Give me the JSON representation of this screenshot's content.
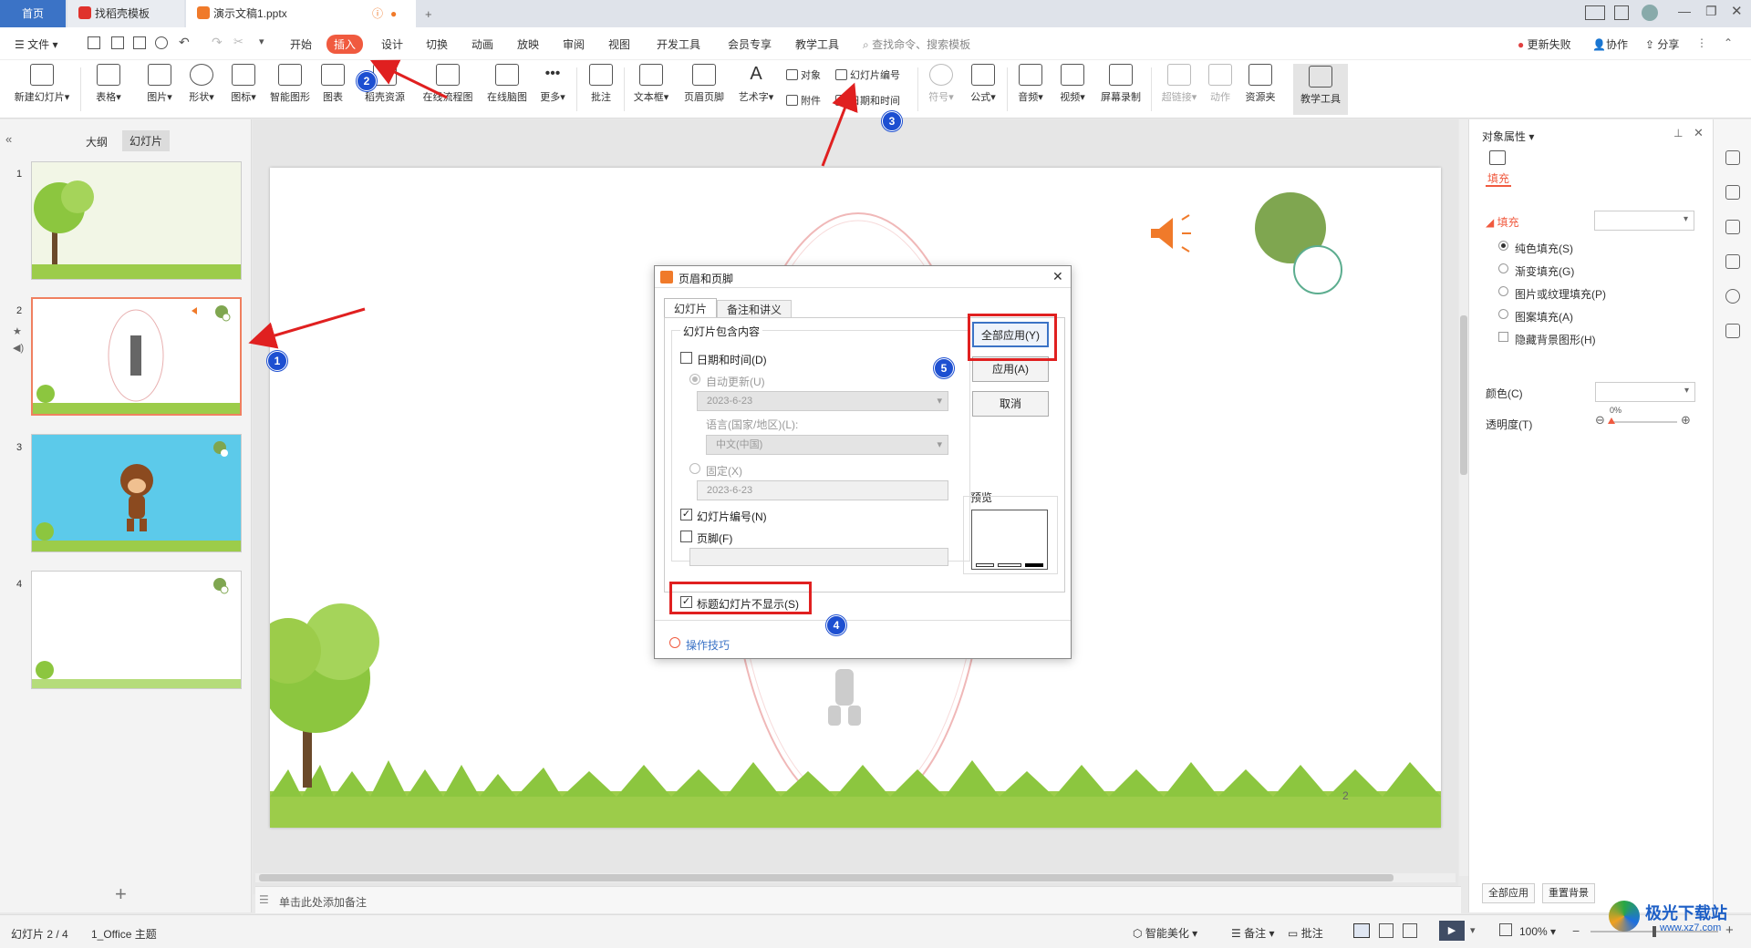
{
  "tabs": {
    "home": "首页",
    "template": "找稻壳模板",
    "doc": "演示文稿1.pptx",
    "new_tab": "+"
  },
  "menubar": {
    "file": "文件",
    "items": [
      "开始",
      "插入",
      "设计",
      "切换",
      "动画",
      "放映",
      "审阅",
      "视图",
      "开发工具",
      "会员专享",
      "教学工具"
    ],
    "search_placeholder": "查找命令、搜索模板",
    "update_failed": "更新失败",
    "collab": "协作",
    "share": "分享"
  },
  "ribbon": {
    "new_slide": "新建幻灯片",
    "table": "表格",
    "picture": "图片",
    "shape": "形状",
    "icon": "图标",
    "smart_graphic": "智能图形",
    "chart": "图表",
    "daoke": "稻壳资源",
    "flowchart": "在线流程图",
    "mindmap": "在线脑图",
    "more": "更多",
    "comment": "批注",
    "textbox": "文本框",
    "header_footer": "页眉页脚",
    "wordart": "艺术字",
    "object": "对象",
    "slide_number": "幻灯片编号",
    "attachment": "附件",
    "datetime": "日期和时间",
    "symbol": "符号",
    "formula": "公式",
    "audio": "音频",
    "video": "视频",
    "screen_record": "屏幕录制",
    "hyperlink": "超链接",
    "action": "动作",
    "resource": "资源夹",
    "teach_tool": "教学工具"
  },
  "left_panel": {
    "outline_tab": "大纲",
    "slides_tab": "幻灯片",
    "slide_numbers": [
      "1",
      "2",
      "3",
      "4"
    ]
  },
  "notes_placeholder": "单击此处添加备注",
  "slide_page_number": "2",
  "dialog": {
    "title": "页眉和页脚",
    "tab_slide": "幻灯片",
    "tab_notes": "备注和讲义",
    "group_title": "幻灯片包含内容",
    "datetime_label": "日期和时间(D)",
    "auto_update": "自动更新(U)",
    "date_value": "2023-6-23",
    "language_label": "语言(国家/地区)(L):",
    "language_value": "中文(中国)",
    "fixed_label": "固定(X)",
    "fixed_value": "2023-6-23",
    "slide_number_label": "幻灯片编号(N)",
    "footer_label": "页脚(F)",
    "hide_title_label": "标题幻灯片不显示(S)",
    "apply_all": "全部应用(Y)",
    "apply": "应用(A)",
    "cancel": "取消",
    "preview": "预览",
    "tips": "操作技巧",
    "slide_number_checked": true,
    "hide_title_checked": true,
    "datetime_checked": false,
    "footer_checked": false
  },
  "badges": [
    "1",
    "2",
    "3",
    "4",
    "5"
  ],
  "right_panel": {
    "title": "对象属性",
    "fill_tab": "填充",
    "fill_section": "填充",
    "solid_fill": "纯色填充(S)",
    "gradient_fill": "渐变填充(G)",
    "picture_fill": "图片或纹理填充(P)",
    "pattern_fill": "图案填充(A)",
    "hide_bg": "隐藏背景图形(H)",
    "color_label": "颜色(C)",
    "transparency_label": "透明度(T)",
    "transparency_value": "0%",
    "apply_all": "全部应用",
    "reset_bg": "重置背景"
  },
  "statusbar": {
    "slide_info": "幻灯片 2 / 4",
    "theme": "1_Office 主题",
    "smart_beautify": "智能美化",
    "notes": "备注",
    "comments": "批注",
    "zoom": "100%"
  },
  "watermark": {
    "name": "极光下载站",
    "url": "www.xz7.com"
  },
  "colors": {
    "accent_red": "#e02020",
    "badge_blue": "#1d4fd1",
    "insert_tab": "#f05a3f",
    "wps_blue": "#3b73c6"
  }
}
